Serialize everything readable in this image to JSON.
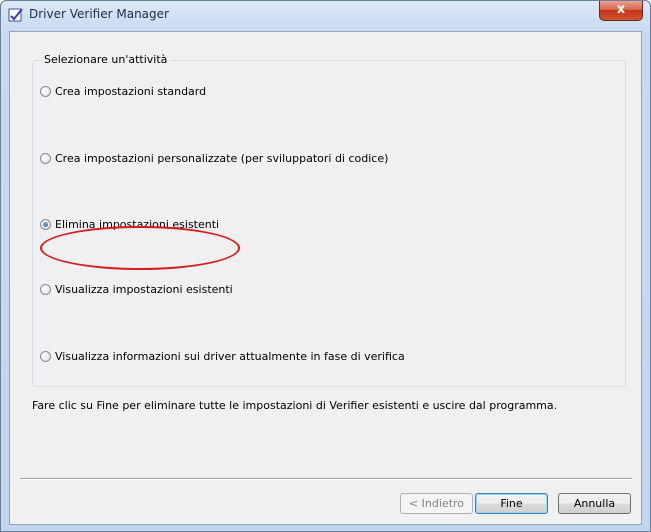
{
  "window": {
    "title": "Driver Verifier Manager",
    "close_label": "x"
  },
  "group": {
    "title": "Selezionare un'attività",
    "options": [
      {
        "label": "Crea impostazioni standard",
        "checked": false
      },
      {
        "label": "Crea impostazioni personalizzate (per sviluppatori di codice)",
        "checked": false
      },
      {
        "label": "Elimina impostazioni esistenti",
        "checked": true
      },
      {
        "label": "Visualizza impostazioni esistenti",
        "checked": false
      },
      {
        "label": "Visualizza informazioni sui driver attualmente in fase di verifica",
        "checked": false
      }
    ]
  },
  "info_text": "Fare clic su Fine per eliminare tutte le impostazioni di Verifier esistenti e uscire dal programma.",
  "buttons": {
    "back": "< Indietro",
    "finish": "Fine",
    "cancel": "Annulla"
  },
  "colors": {
    "highlight": "#d81c1c",
    "radio_selected": "#1f5fad"
  }
}
